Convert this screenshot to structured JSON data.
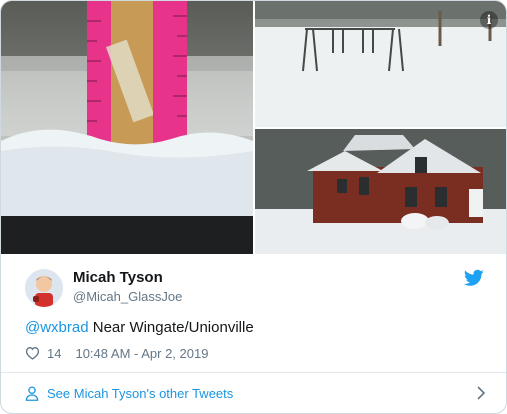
{
  "media": {
    "info_glyph": "i",
    "photos": [
      {
        "name": "snow-depth-ruler-photo"
      },
      {
        "name": "snowy-swingset-photo"
      },
      {
        "name": "snowy-brick-house-photo"
      }
    ]
  },
  "user": {
    "name": "Micah Tyson",
    "handle": "@Micah_GlassJoe",
    "avatar_icon": "avatar-icon"
  },
  "tweet": {
    "mention": "@wxbrad",
    "text": " Near Wingate/Unionville",
    "likes": "14",
    "timestamp": "10:48 AM - Apr 2, 2019"
  },
  "footer": {
    "link_label": "See Micah Tyson's other Tweets"
  },
  "colors": {
    "link_blue": "#1b95e0",
    "twitter_blue": "#1da1f2",
    "text_primary": "#14171a",
    "text_secondary": "#657786",
    "border": "#e1e8ed"
  }
}
